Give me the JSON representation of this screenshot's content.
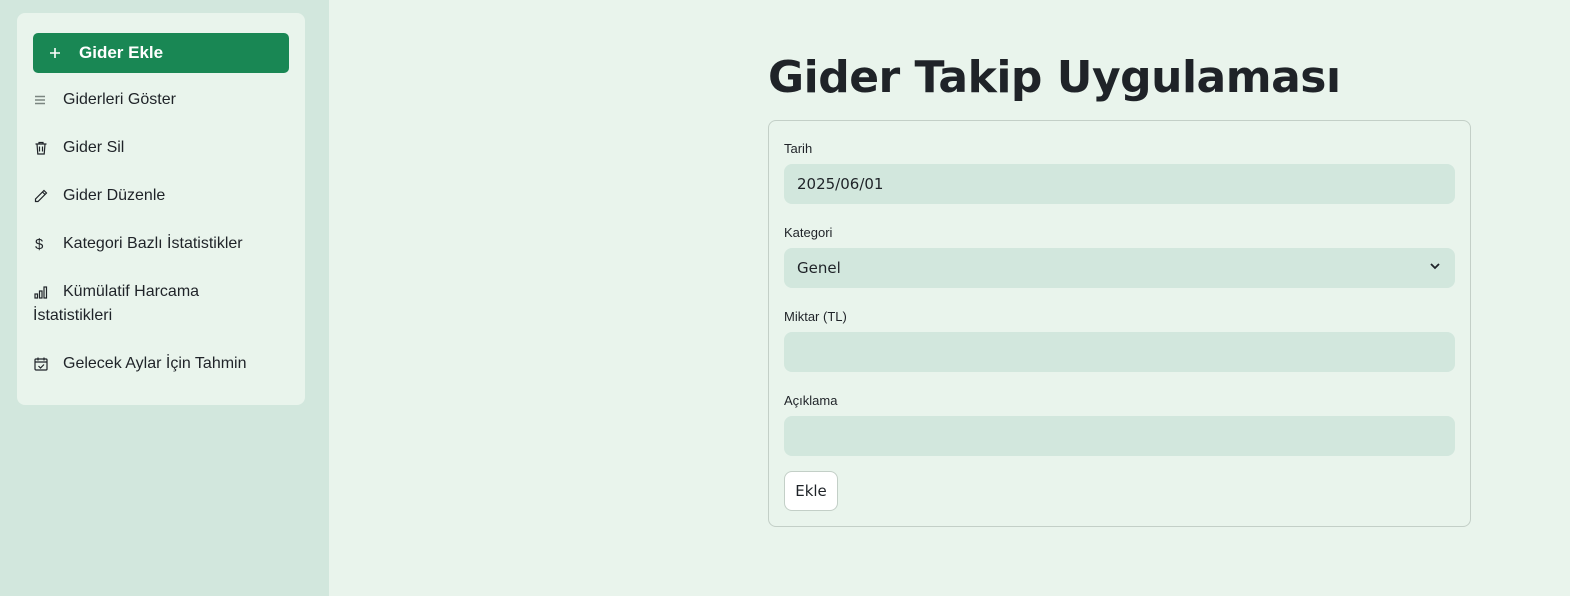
{
  "sidebar": {
    "items": [
      {
        "label": "Gider Ekle",
        "icon": "plus-icon",
        "active": true
      },
      {
        "label": "Giderleri Göster",
        "icon": "list-icon"
      },
      {
        "label": "Gider Sil",
        "icon": "trash-icon"
      },
      {
        "label": "Gider Düzenle",
        "icon": "pencil-icon"
      },
      {
        "label": "Kategori Bazlı İstatistikler",
        "icon": "dollar-icon"
      },
      {
        "label_line1": "Kümülatif Harcama",
        "label_line2": "İstatistikleri",
        "icon": "bar-chart-icon"
      },
      {
        "label": "Gelecek Aylar İçin Tahmin",
        "icon": "calendar-check-icon"
      }
    ]
  },
  "main": {
    "title": "Gider Takip Uygulaması",
    "form": {
      "date_label": "Tarih",
      "date_value": "2025/06/01",
      "category_label": "Kategori",
      "category_value": "Genel",
      "amount_label": "Miktar (TL)",
      "amount_value": "",
      "description_label": "Açıklama",
      "description_value": "",
      "submit_label": "Ekle"
    }
  },
  "colors": {
    "accent": "#198754",
    "sidebar_bg": "#d2e7dd",
    "page_bg": "#e9f4ec",
    "input_bg": "#d2e7dd"
  }
}
